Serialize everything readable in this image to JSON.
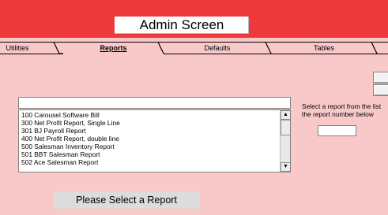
{
  "header": {
    "title": "Admin Screen"
  },
  "tabs": [
    {
      "label": "Utilities",
      "active": false
    },
    {
      "label": "Reports",
      "active": true
    },
    {
      "label": "Defaults",
      "active": false
    },
    {
      "label": "Tables",
      "active": false
    }
  ],
  "report_filter": {
    "value": ""
  },
  "report_list": {
    "items": [
      "100 Carousel Software Bill",
      "300 Net Profit Report, Single Line",
      "301 BJ Payroll Report",
      "400 Net Profit Report, double line",
      "500 Salesman Inventory Report",
      "501 BBT Salesman Report",
      "502 Ace Salesman Report"
    ]
  },
  "instruction": {
    "line1": "Select a report from the list",
    "line2": "the report number below"
  },
  "report_number": {
    "value": ""
  },
  "status": {
    "message": "Please Select a Report"
  },
  "colors": {
    "header_band": "#ee3a3c",
    "background": "#f9c9ca",
    "status_box": "#dcdcdc"
  }
}
